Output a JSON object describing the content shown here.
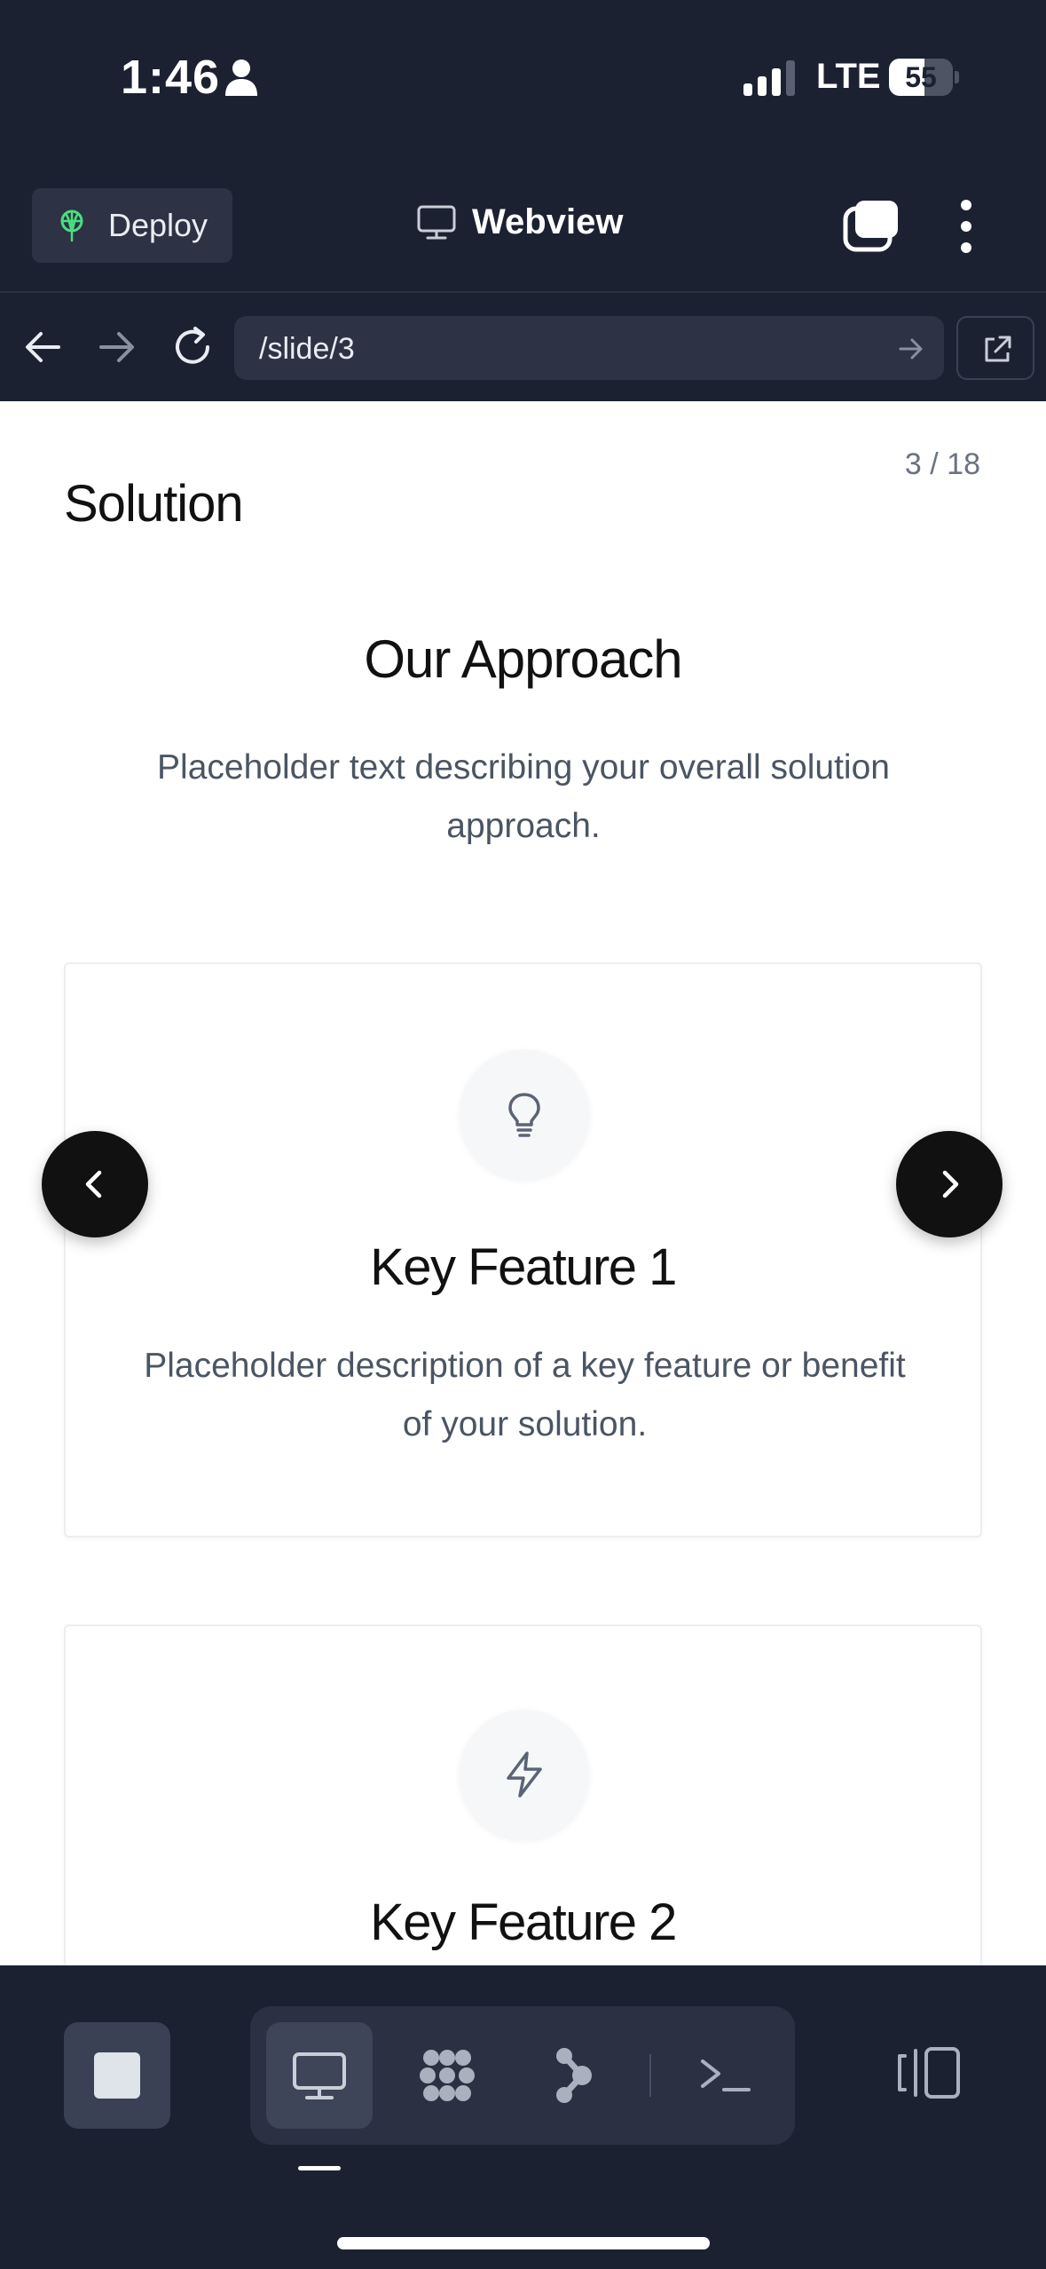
{
  "status_bar": {
    "time": "1:46",
    "network": "LTE",
    "battery_level": "55",
    "battery_fraction": 0.55
  },
  "toolbar": {
    "deploy_label": "Deploy",
    "title": "Webview",
    "icons": [
      "deploy-icon",
      "monitor-icon",
      "tabs-icon",
      "more-icon"
    ]
  },
  "urlbar": {
    "url": "/slide/3"
  },
  "slide": {
    "counter": "3 / 18",
    "section": "Solution",
    "heading": "Our Approach",
    "subtitle": "Placeholder text describing your overall solution approach.",
    "features": [
      {
        "title": "Key Feature 1",
        "description": "Placeholder description of a key feature or benefit of your solution.",
        "icon": "lightbulb-icon"
      },
      {
        "title": "Key Feature 2",
        "icon": "lightning-icon"
      }
    ]
  },
  "bottom_bar": {
    "active_view": "webview",
    "views": [
      "webview",
      "grid",
      "graph",
      "terminal"
    ]
  },
  "colors": {
    "chrome_background": "#1c2132",
    "field_background": "#2d3344",
    "deploy_accent": "#4ade80",
    "text_primary": "#111111",
    "text_secondary": "#4b5563",
    "carousel_button": "#111111"
  }
}
